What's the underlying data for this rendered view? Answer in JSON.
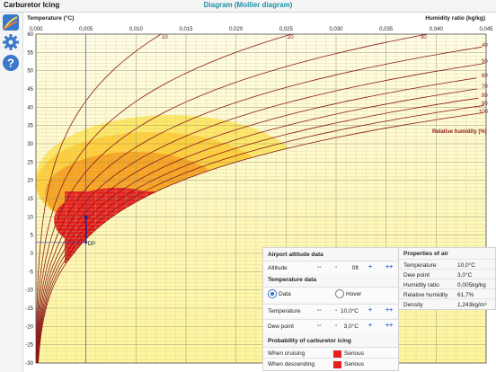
{
  "app": {
    "title": "Carburetor Icing",
    "diagram_title": "Diagram (Mollier diagram)"
  },
  "sidebar": [
    {
      "name": "diagram-icon",
      "label": "Diagram"
    },
    {
      "name": "gear-icon",
      "label": "Settings"
    },
    {
      "name": "help-icon",
      "label": "Help"
    }
  ],
  "axes": {
    "y_label": "Temperature (°C)",
    "x_label": "Humidity ratio (kg/kg)",
    "rh_label": "Relative humidity (%)",
    "y_ticks": [
      "60",
      "55",
      "50",
      "45",
      "40",
      "35",
      "30",
      "25",
      "20",
      "15",
      "10",
      "5",
      "0",
      "-5",
      "-10",
      "-15",
      "-20",
      "-25",
      "-30"
    ],
    "x_ticks": [
      "0,000",
      "0,005",
      "0,010",
      "0,015",
      "0,020",
      "0,025",
      "0,030",
      "0,035",
      "0,040",
      "0,045"
    ],
    "rh_curves": [
      "10",
      "20",
      "30",
      "40",
      "50",
      "60",
      "70",
      "80",
      "90",
      "100"
    ],
    "dew_point_label": "DP"
  },
  "chart_data": {
    "type": "line",
    "title": "Diagram (Mollier diagram)",
    "xlabel": "Humidity ratio (kg/kg)",
    "ylabel": "Temperature (°C)",
    "xlim": [
      0,
      0.045
    ],
    "ylim": [
      -30,
      60
    ],
    "relative_humidity_curves_percent": [
      10,
      20,
      30,
      40,
      50,
      60,
      70,
      80,
      90,
      100
    ],
    "icing_zones": [
      "Serious icing at cruise power",
      "Serious icing at descent power",
      "Moderate icing",
      "Light icing"
    ],
    "current_point": {
      "temperature_c": 10.0,
      "dew_point_c": 3.0,
      "humidity_ratio": 0.005
    },
    "grid": true
  },
  "panel": {
    "airport_title": "Airport altitude data",
    "altitude": {
      "label": "Altitude",
      "value": "0ft",
      "minus2": "--",
      "minus1": "-",
      "plus1": "+",
      "plus2": "++"
    },
    "temp_title": "Temperature data",
    "mode_data": "Data",
    "mode_hover": "Hover",
    "temperature": {
      "label": "Temperature",
      "value": "10,0°C",
      "minus2": "--",
      "minus1": "-",
      "plus1": "+",
      "plus2": "++"
    },
    "dewpoint": {
      "label": "Dew point",
      "value": "3,0°C",
      "minus2": "--",
      "minus1": "-",
      "plus1": "+",
      "plus2": "++"
    },
    "prob_title": "Probability of carburetor icing",
    "cruising": {
      "label": "When cruising",
      "value": "Serious"
    },
    "descending": {
      "label": "When descending",
      "value": "Serious"
    }
  },
  "properties": {
    "title": "Properties of air",
    "rows": [
      {
        "label": "Temperature",
        "value": "10,0°C"
      },
      {
        "label": "Dew point",
        "value": "3,0°C"
      },
      {
        "label": "Humidity ratio",
        "value": "0,005kg/kg"
      },
      {
        "label": "Relative humidity",
        "value": "61,7%"
      },
      {
        "label": "Density",
        "value": "1,243kg/m³"
      }
    ]
  },
  "colors": {
    "accent": "#2f6fd0",
    "curve": "#8b1a1a",
    "title": "#1a8fa8",
    "serious": "#e8201c"
  }
}
